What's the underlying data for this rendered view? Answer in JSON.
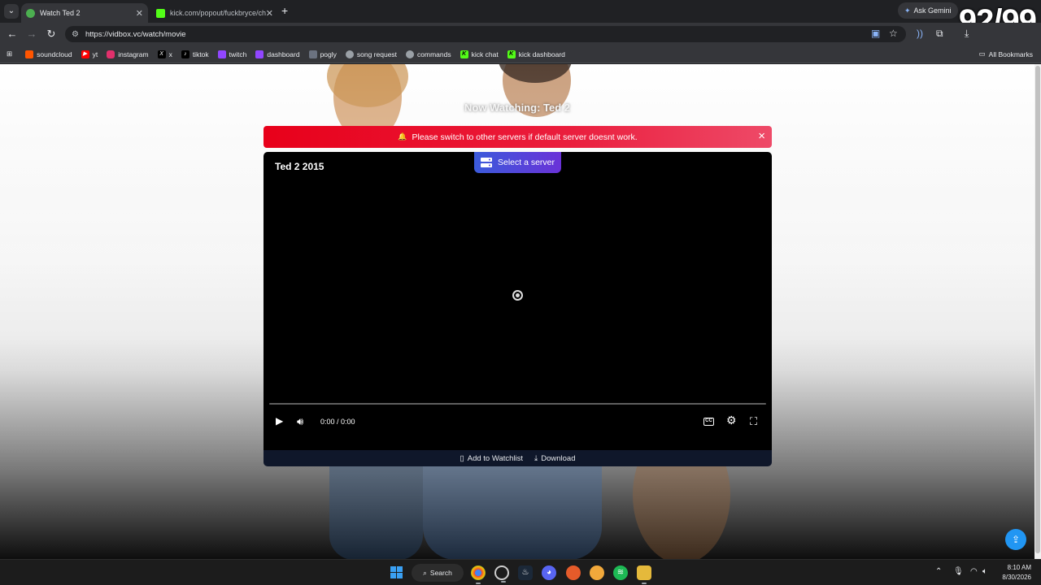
{
  "browser": {
    "tabs": [
      {
        "title": "Watch Ted 2",
        "active": true,
        "favicon_color": "#4caf50"
      },
      {
        "title": "kick.com/popout/fuckbryce/ch",
        "active": false,
        "favicon_color": "#53fc18"
      }
    ],
    "new_tab_label": "+",
    "gemini_label": "Ask Gemini",
    "overlay_counter": "92/99",
    "url": "https://vidbox.vc/watch/movie",
    "bookmarks": [
      {
        "label": "soundcloud",
        "icon": "soundcloud-icon",
        "color": "#ff5500"
      },
      {
        "label": "yt",
        "icon": "youtube-icon",
        "color": "#ff0000"
      },
      {
        "label": "instagram",
        "icon": "instagram-icon",
        "color": "#e1306c"
      },
      {
        "label": "x",
        "icon": "x-icon",
        "color": "#000000"
      },
      {
        "label": "tiktok",
        "icon": "tiktok-icon",
        "color": "#000000"
      },
      {
        "label": "twitch",
        "icon": "twitch-icon",
        "color": "#9146ff"
      },
      {
        "label": "dashboard",
        "icon": "twitch-icon",
        "color": "#9146ff"
      },
      {
        "label": "pogly",
        "icon": "pogly-icon",
        "color": "#6b7280"
      },
      {
        "label": "song request",
        "icon": "bot-icon",
        "color": "#9aa0a6"
      },
      {
        "label": "commands",
        "icon": "bot-icon",
        "color": "#9aa0a6"
      },
      {
        "label": "kick chat",
        "icon": "kick-icon",
        "color": "#53fc18"
      },
      {
        "label": "kick dashboard",
        "icon": "kick-icon",
        "color": "#53fc18"
      }
    ],
    "all_bookmarks_label": "All Bookmarks"
  },
  "page": {
    "now_watching": "Now Watching: Ted 2",
    "alert_text": "Please switch to other servers if default server doesnt work.",
    "alert_close": "×",
    "player": {
      "movie_title": "Ted 2 2015",
      "server_button": "Select a server",
      "time": "0:00 / 0:00",
      "progress": 0
    },
    "footer": {
      "watchlist": "Add to Watchlist",
      "download": "Download"
    }
  },
  "taskbar": {
    "search_label": "Search",
    "time": "8:10 AM",
    "date": "8/30/2026"
  },
  "colors": {
    "alert_start": "#e8001a",
    "server_button_start": "#3b5bdb",
    "server_button_end": "#6a32d8",
    "fab": "#2196f3"
  }
}
